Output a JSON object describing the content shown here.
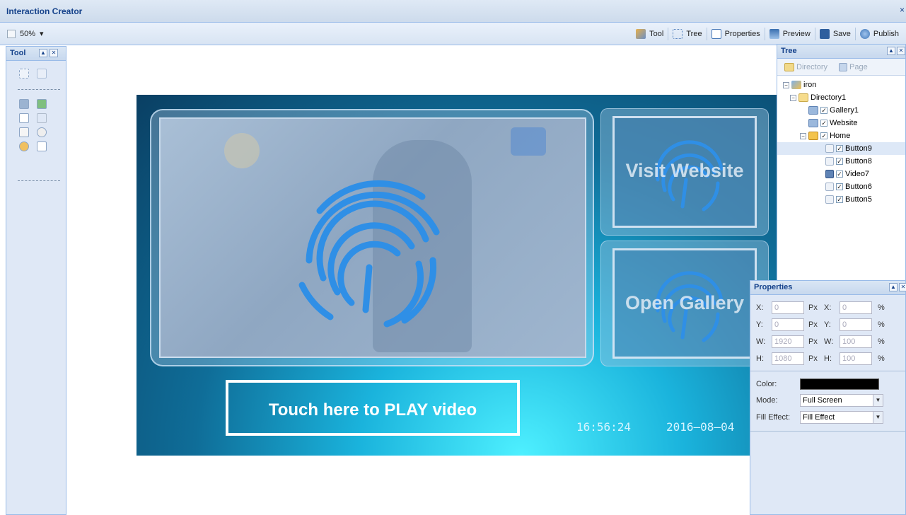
{
  "app": {
    "title": "Interaction Creator",
    "close": "×"
  },
  "toolbar": {
    "zoom": "50%",
    "items": [
      {
        "label": "Tool",
        "icon": "tool-icon"
      },
      {
        "label": "Tree",
        "icon": "tree-icon"
      },
      {
        "label": "Properties",
        "icon": "properties-icon"
      },
      {
        "label": "Preview",
        "icon": "preview-icon"
      },
      {
        "label": "Save",
        "icon": "save-icon"
      },
      {
        "label": "Publish",
        "icon": "publish-icon"
      }
    ]
  },
  "tool_panel": {
    "title": "Tool"
  },
  "stage": {
    "visit_label": "Visit Website",
    "gallery_label": "Open Gallery",
    "play_label": "Touch here to PLAY video",
    "time": "16:56:24",
    "date": "2016–08–04"
  },
  "tree_panel": {
    "title": "Tree",
    "tabs": {
      "directory": "Directory",
      "page": "Page"
    },
    "nodes": {
      "root": "iron",
      "dir1": "Directory1",
      "gallery1": "Gallery1",
      "website": "Website",
      "home": "Home",
      "b9": "Button9",
      "b8": "Button8",
      "v7": "Video7",
      "b6": "Button6",
      "b5": "Button5"
    }
  },
  "properties": {
    "title": "Properties",
    "x_label": "X:",
    "y_label": "Y:",
    "w_label": "W:",
    "h_label": "H:",
    "px": "Px",
    "pct": "%",
    "x_px": "0",
    "y_px": "0",
    "w_px": "1920",
    "h_px": "1080",
    "x_pct": "0",
    "y_pct": "0",
    "w_pct": "100",
    "h_pct": "100",
    "color_label": "Color:",
    "color_value": "#000000",
    "mode_label": "Mode:",
    "mode_value": "Full Screen",
    "fill_label": "Fill Effect:",
    "fill_value": "Fill Effect"
  }
}
